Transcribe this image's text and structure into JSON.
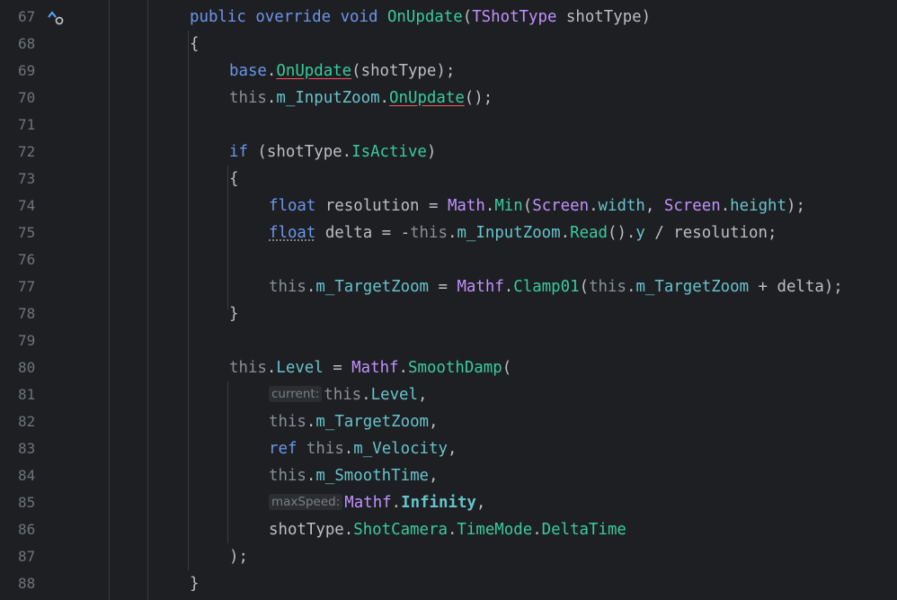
{
  "gutter": {
    "line_numbers": [
      "67",
      "68",
      "69",
      "70",
      "71",
      "72",
      "73",
      "74",
      "75",
      "76",
      "77",
      "78",
      "79",
      "80",
      "81",
      "82",
      "83",
      "84",
      "85",
      "86",
      "87",
      "88"
    ]
  },
  "code": {
    "l67": {
      "kw1": "public",
      "kw2": "override",
      "kw3": "void",
      "method": "OnUpdate",
      "p1": "(",
      "type": "TShotType",
      "p2": " shotType)"
    },
    "l68": {
      "t": "{"
    },
    "l69": {
      "base": "base",
      "dot": ".",
      "method": "OnUpdate",
      "rest": "(shotType);"
    },
    "l70": {
      "this": "this",
      "dot": ".",
      "field": "m_InputZoom",
      "dot2": ".",
      "method": "OnUpdate",
      "rest": "();"
    },
    "l72": {
      "kw": "if",
      "p": " (shotType.",
      "prop": "IsActive",
      "rest": ")"
    },
    "l73": {
      "t": "{"
    },
    "l74": {
      "kw": "float",
      "a": " resolution = ",
      "type1": "Math",
      "d1": ".",
      "fn1": "Min",
      "b": "(",
      "type2": "Screen",
      "d2": ".",
      "prop1": "width",
      "c": ", ",
      "type3": "Screen",
      "d3": ".",
      "prop2": "height",
      "e": ");"
    },
    "l75": {
      "kw": "float",
      "a": " delta = -",
      "this": "this",
      "d1": ".",
      "field": "m_InputZoom",
      "d2": ".",
      "fn": "Read",
      "b": "().",
      "prop": "y",
      "c": " / resolution;"
    },
    "l77": {
      "this1": "this",
      "d1": ".",
      "field1": "m_TargetZoom",
      "a": " = ",
      "type": "Mathf",
      "d2": ".",
      "fn": "Clamp01",
      "b": "(",
      "this2": "this",
      "d3": ".",
      "field2": "m_TargetZoom",
      "c": " + delta);"
    },
    "l78": {
      "t": "}"
    },
    "l80": {
      "this": "this",
      "d1": ".",
      "prop": "Level",
      "a": " = ",
      "type": "Mathf",
      "d2": ".",
      "fn": "SmoothDamp",
      "b": "("
    },
    "l81": {
      "hint": "current:",
      "this": "this",
      "d": ".",
      "prop": "Level",
      "c": ","
    },
    "l82": {
      "this": "this",
      "d": ".",
      "field": "m_TargetZoom",
      "c": ","
    },
    "l83": {
      "kw": "ref",
      "sp": " ",
      "this": "this",
      "d": ".",
      "field": "m_Velocity",
      "c": ","
    },
    "l84": {
      "this": "this",
      "d": ".",
      "field": "m_SmoothTime",
      "c": ","
    },
    "l85": {
      "hint": "maxSpeed:",
      "type": "Mathf",
      "d": ".",
      "prop": "Infinity",
      "c": ","
    },
    "l86": {
      "a": "shotType.",
      "p1": "ShotCamera",
      "d1": ".",
      "p2": "TimeMode",
      "d2": ".",
      "p3": "DeltaTime"
    },
    "l87": {
      "t": ");"
    },
    "l88": {
      "t": "}"
    }
  },
  "colors": {
    "background": "#1e1f22",
    "keyword": "#6c95eb",
    "method": "#39cc9b",
    "type": "#c191ff",
    "field": "#66c3cc",
    "muted": "#8a8e96"
  },
  "icons": {
    "override_marker": "override-up-arrow-icon"
  }
}
